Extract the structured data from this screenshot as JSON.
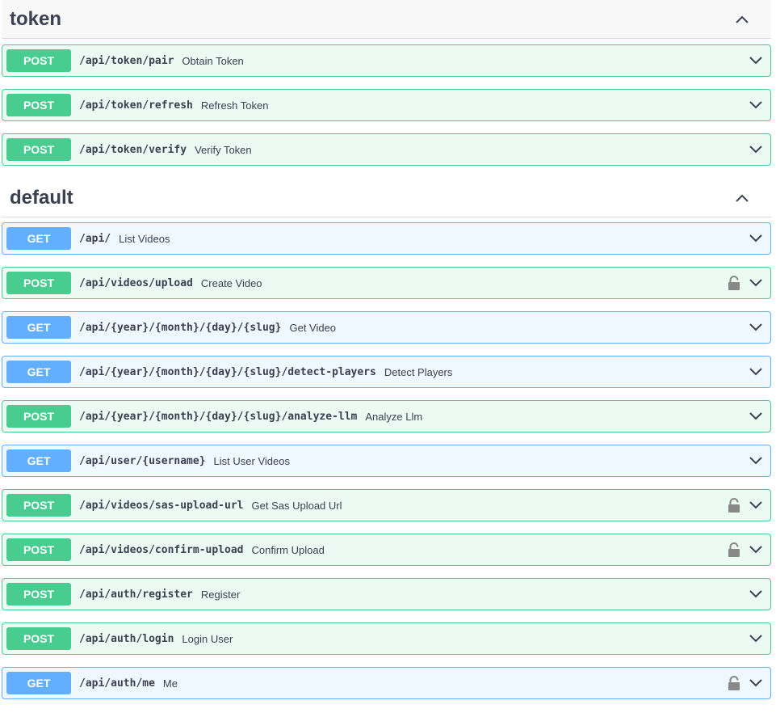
{
  "sections": [
    {
      "title": "token",
      "operations": [
        {
          "method": "POST",
          "path": "/api/token/pair",
          "summary": "Obtain Token",
          "locked": false
        },
        {
          "method": "POST",
          "path": "/api/token/refresh",
          "summary": "Refresh Token",
          "locked": false
        },
        {
          "method": "POST",
          "path": "/api/token/verify",
          "summary": "Verify Token",
          "locked": false
        }
      ]
    },
    {
      "title": "default",
      "operations": [
        {
          "method": "GET",
          "path": "/api/",
          "summary": "List Videos",
          "locked": false
        },
        {
          "method": "POST",
          "path": "/api/videos/upload",
          "summary": "Create Video",
          "locked": true
        },
        {
          "method": "GET",
          "path": "/api/{year}/{month}/{day}/{slug}",
          "summary": "Get Video",
          "locked": false
        },
        {
          "method": "GET",
          "path": "/api/{year}/{month}/{day}/{slug}/detect-players",
          "summary": "Detect Players",
          "locked": false
        },
        {
          "method": "POST",
          "path": "/api/{year}/{month}/{day}/{slug}/analyze-llm",
          "summary": "Analyze Llm",
          "locked": false
        },
        {
          "method": "GET",
          "path": "/api/user/{username}",
          "summary": "List User Videos",
          "locked": false
        },
        {
          "method": "POST",
          "path": "/api/videos/sas-upload-url",
          "summary": "Get Sas Upload Url",
          "locked": true
        },
        {
          "method": "POST",
          "path": "/api/videos/confirm-upload",
          "summary": "Confirm Upload",
          "locked": true
        },
        {
          "method": "POST",
          "path": "/api/auth/register",
          "summary": "Register",
          "locked": false
        },
        {
          "method": "POST",
          "path": "/api/auth/login",
          "summary": "Login User",
          "locked": false
        },
        {
          "method": "GET",
          "path": "/api/auth/me",
          "summary": "Me",
          "locked": true
        }
      ]
    }
  ],
  "colors": {
    "post": "#49cc90",
    "get": "#61affe",
    "text": "#3b4151"
  }
}
